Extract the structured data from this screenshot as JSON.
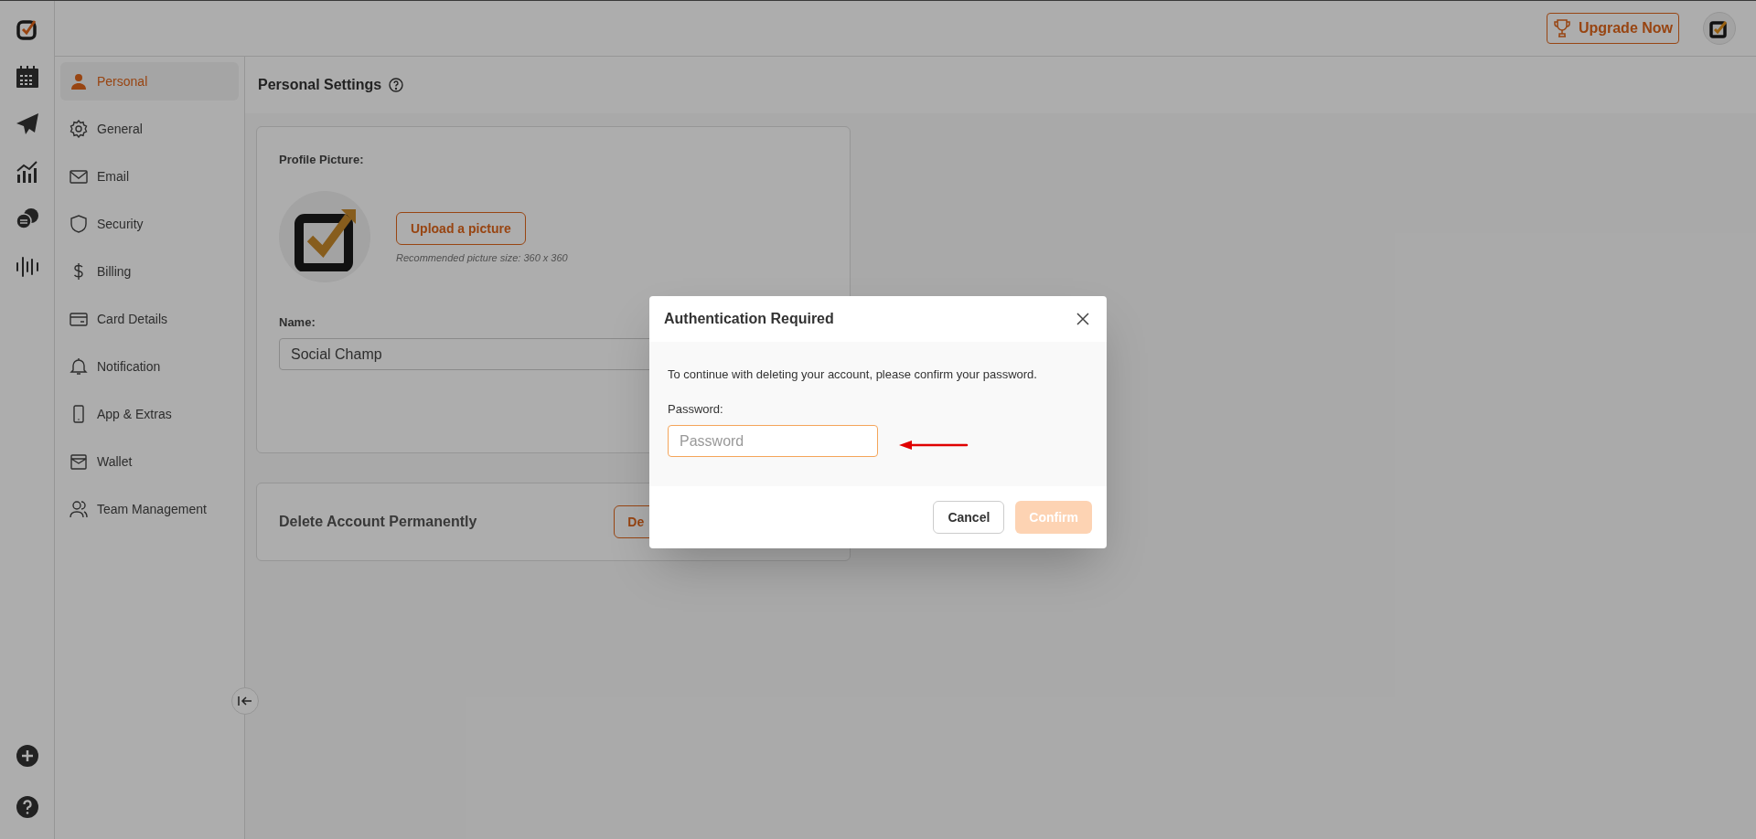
{
  "header": {
    "upgrade_button": "Upgrade Now"
  },
  "rail": [
    {
      "kind": "logo"
    },
    {
      "kind": "calendar"
    },
    {
      "kind": "send"
    },
    {
      "kind": "chart"
    },
    {
      "kind": "chat"
    },
    {
      "kind": "wave"
    }
  ],
  "rail_bottom": [
    {
      "kind": "plus"
    },
    {
      "kind": "help"
    }
  ],
  "sidebar": {
    "items": [
      {
        "label": "Personal",
        "kind": "person",
        "selected": true
      },
      {
        "label": "General",
        "kind": "gear",
        "selected": false
      },
      {
        "label": "Email",
        "kind": "mail",
        "selected": false
      },
      {
        "label": "Security",
        "kind": "shield",
        "selected": false
      },
      {
        "label": "Billing",
        "kind": "dollar",
        "selected": false
      },
      {
        "label": "Card Details",
        "kind": "card",
        "selected": false
      },
      {
        "label": "Notification",
        "kind": "bell",
        "selected": false
      },
      {
        "label": "App & Extras",
        "kind": "phone",
        "selected": false
      },
      {
        "label": "Wallet",
        "kind": "wallet",
        "selected": false
      },
      {
        "label": "Team Management",
        "kind": "team",
        "selected": false
      }
    ]
  },
  "page_title": "Personal Settings",
  "profile": {
    "picture_label": "Profile Picture:",
    "upload_button": "Upload a picture",
    "hint": "Recommended picture size: 360 x 360",
    "name_label": "Name:",
    "name_value": "Social Champ"
  },
  "delete_section": {
    "title": "Delete Account Permanently",
    "button": "De"
  },
  "modal": {
    "title": "Authentication Required",
    "message": "To continue with deleting your account, please confirm your password.",
    "password_label": "Password:",
    "password_placeholder": "Password",
    "cancel": "Cancel",
    "confirm": "Confirm",
    "confirm_disabled": true
  }
}
